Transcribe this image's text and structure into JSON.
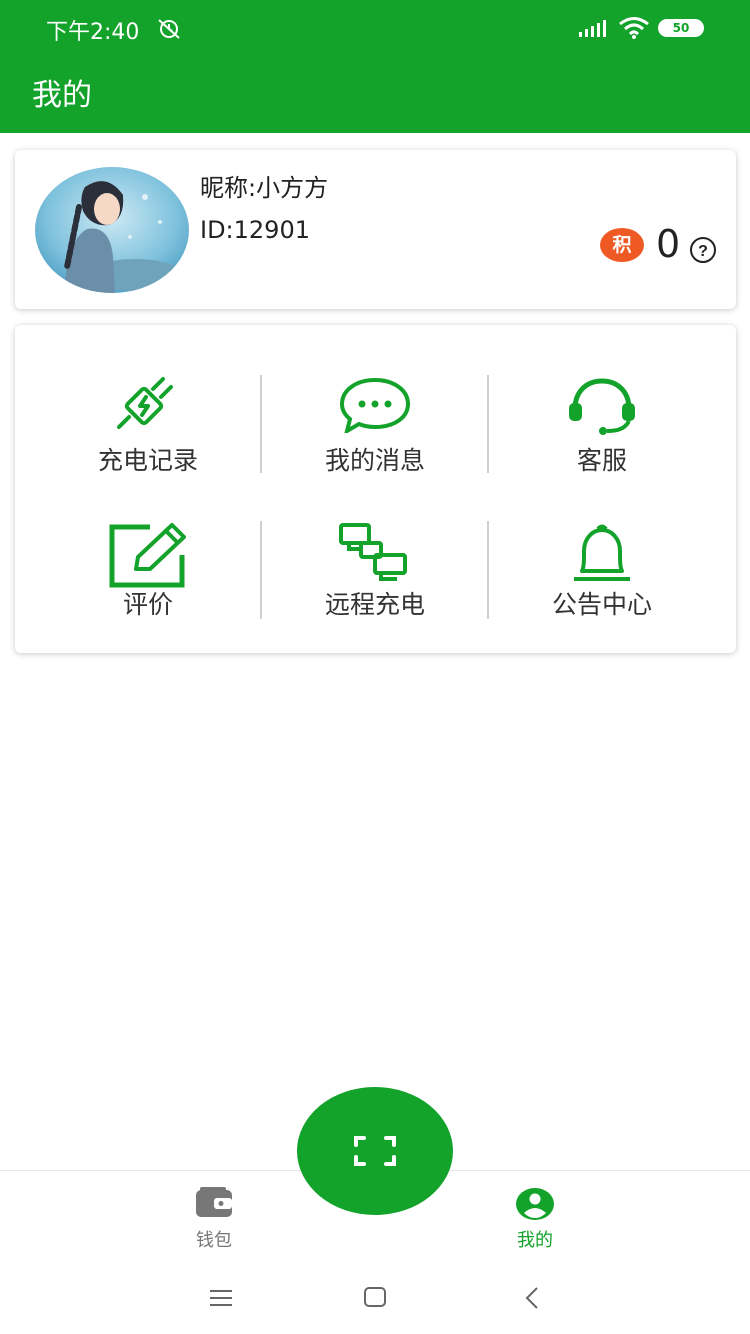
{
  "status_bar": {
    "time": "下午2:40",
    "battery": "50"
  },
  "header": {
    "title": "我的"
  },
  "profile": {
    "nickname": "昵称:小方方",
    "user_id": "ID:12901",
    "points_badge": "积",
    "points": "0"
  },
  "menu": {
    "items": [
      {
        "label": "充电记录",
        "icon": "plug-icon"
      },
      {
        "label": "我的消息",
        "icon": "chat-bubble-icon"
      },
      {
        "label": "客服",
        "icon": "headset-icon"
      },
      {
        "label": "评价",
        "icon": "edit-icon"
      },
      {
        "label": "远程充电",
        "icon": "remote-network-icon"
      },
      {
        "label": "公告中心",
        "icon": "bell-icon"
      }
    ]
  },
  "tabbar": {
    "tabs": [
      {
        "label": "钱包",
        "icon": "wallet-icon",
        "active": false
      },
      {
        "label": "我的",
        "icon": "user-icon",
        "active": true
      }
    ],
    "scan_icon": "scan-icon"
  },
  "colors": {
    "brand": "#13a22a",
    "points_badge": "#ef5a24",
    "inactive_tab": "#777777"
  }
}
